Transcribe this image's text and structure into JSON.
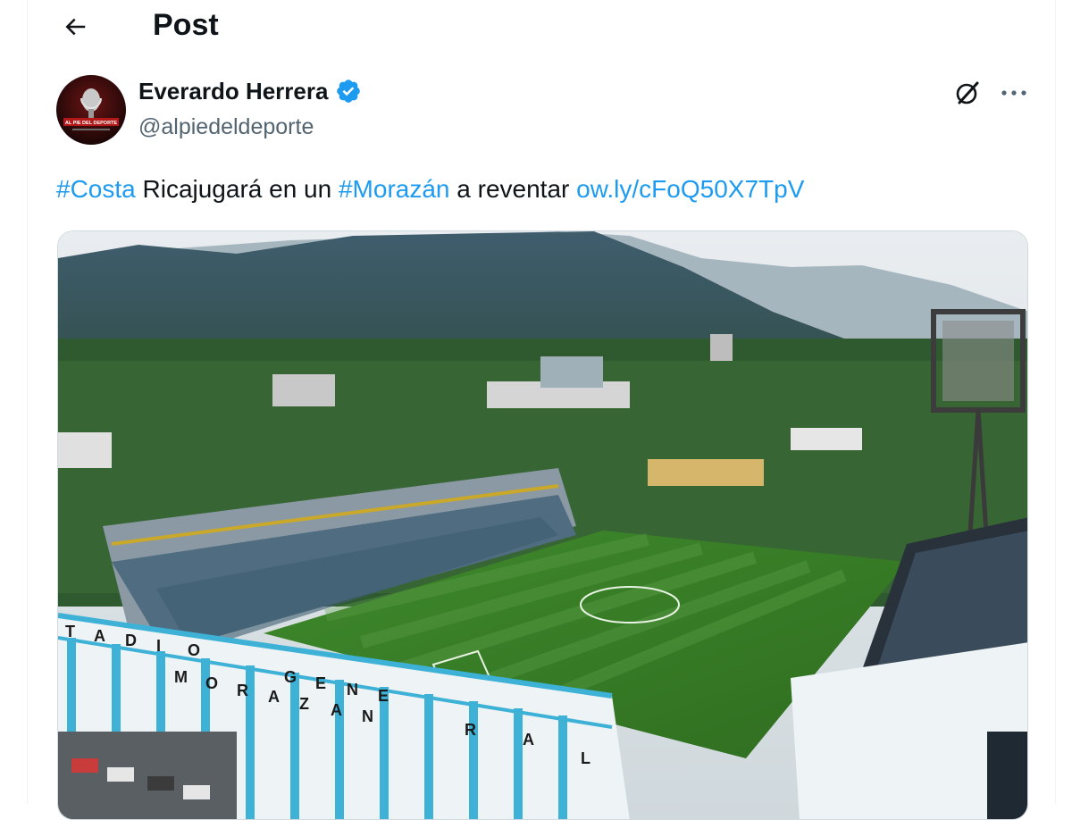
{
  "header": {
    "title": "Post"
  },
  "author": {
    "name": "Everardo Herrera",
    "handle": "@alpiedeldeporte",
    "verified": true,
    "avatar_caption": "AL PIE DEL DEPORTE"
  },
  "post": {
    "segments": [
      {
        "type": "hashtag",
        "text": "#Costa"
      },
      {
        "type": "text",
        "text": " Ricajugará en un "
      },
      {
        "type": "hashtag",
        "text": "#Morazán"
      },
      {
        "type": "text",
        "text": " a reventar "
      },
      {
        "type": "link",
        "text": "ow.ly/cFoQ50X7TpV"
      }
    ]
  },
  "media": {
    "stadium_letters_top": [
      "T",
      "A",
      "D",
      "I",
      "O"
    ],
    "stadium_letters_bottom": [
      "M",
      "O",
      "R",
      "A",
      "Z",
      "A",
      "N",
      "G",
      "E",
      "N",
      "E",
      "R",
      "A",
      "L"
    ]
  },
  "icons": {
    "back": "arrow-left-icon",
    "verified": "verified-badge-icon",
    "grok": "grok-icon",
    "more": "more-dots-icon"
  },
  "colors": {
    "accent": "#1d9bf0",
    "secondary_text": "#536471",
    "text": "#0f1419"
  }
}
